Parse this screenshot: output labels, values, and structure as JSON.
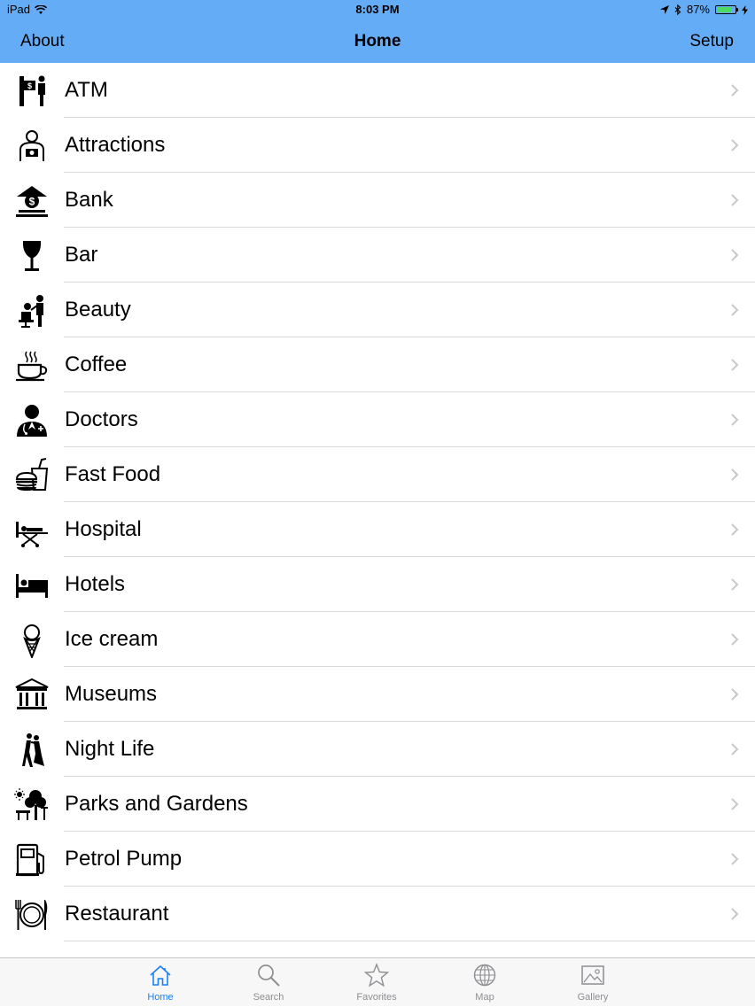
{
  "status": {
    "device": "iPad",
    "time": "8:03 PM",
    "battery": "87%",
    "battery_level": 0.87
  },
  "nav": {
    "left": "About",
    "title": "Home",
    "right": "Setup"
  },
  "items": [
    {
      "label": "ATM",
      "icon": "atm-icon"
    },
    {
      "label": "Attractions",
      "icon": "photographer-icon"
    },
    {
      "label": "Bank",
      "icon": "bank-icon"
    },
    {
      "label": "Bar",
      "icon": "wine-glass-icon"
    },
    {
      "label": "Beauty",
      "icon": "salon-icon"
    },
    {
      "label": "Coffee",
      "icon": "coffee-cup-icon"
    },
    {
      "label": "Doctors",
      "icon": "doctor-icon"
    },
    {
      "label": "Fast Food",
      "icon": "burger-drink-icon"
    },
    {
      "label": "Hospital",
      "icon": "hospital-bed-icon"
    },
    {
      "label": "Hotels",
      "icon": "bed-icon"
    },
    {
      "label": "Ice cream",
      "icon": "ice-cream-icon"
    },
    {
      "label": "Museums",
      "icon": "museum-icon"
    },
    {
      "label": "Night Life",
      "icon": "dancing-couple-icon"
    },
    {
      "label": "Parks and Gardens",
      "icon": "park-icon"
    },
    {
      "label": "Petrol Pump",
      "icon": "fuel-pump-icon"
    },
    {
      "label": "Restaurant",
      "icon": "plate-cutlery-icon"
    }
  ],
  "tabs": [
    {
      "label": "Home",
      "icon": "home-icon",
      "active": true
    },
    {
      "label": "Search",
      "icon": "search-icon",
      "active": false
    },
    {
      "label": "Favorites",
      "icon": "star-icon",
      "active": false
    },
    {
      "label": "Map",
      "icon": "globe-icon",
      "active": false
    },
    {
      "label": "Gallery",
      "icon": "gallery-icon",
      "active": false
    }
  ],
  "colors": {
    "navbar": "#65acf7",
    "active_tab": "#1b7ff5",
    "inactive_tab": "#8e8e93"
  }
}
